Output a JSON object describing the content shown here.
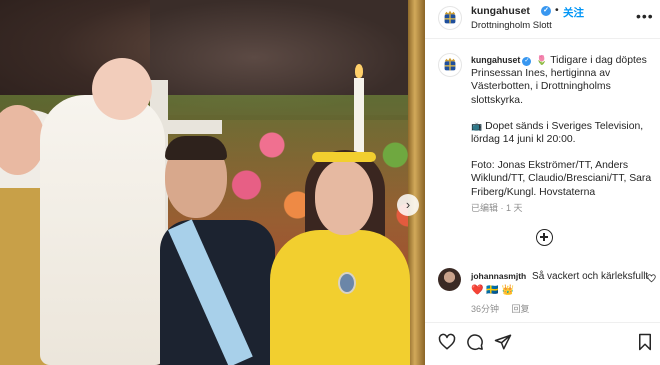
{
  "post": {
    "username": "kungahuset",
    "follow_dot": "•",
    "follow_label": "关注",
    "location": "Drottningholm Slott",
    "more_label": "•••"
  },
  "caption": {
    "username": "kungahuset",
    "line1_emoji": "🌷",
    "line1": "Tidigare i dag döptes Prinsessan Ines, hertiginna av Västerbotten, i Drottningholms slottskyrka.",
    "line2_emoji": "📺",
    "line2": "Dopet sänds i Sveriges Television, lördag 14 juni kl 20:00.",
    "line3": "Foto: Jonas Ekströmer/TT, Anders Wiklund/TT, Claudio/Bresciani/TT, Sara Friberg/Kungl. Hovstaterna",
    "edited": "已编辑",
    "dot": "·",
    "time": "1 天"
  },
  "comment": {
    "username": "johannasmjth",
    "text": "Så vackert och kärleksfullt",
    "emojis": "❤️ 🇸🇪 👑",
    "time": "36分钟",
    "reply": "回复"
  },
  "photo": {
    "next_arrow": "›"
  },
  "icons": {
    "header_avatar": "royal-crest-icon",
    "like": "heart-icon",
    "comment": "comment-icon",
    "share": "paper-plane-icon",
    "save": "bookmark-icon",
    "load_more": "plus-circle-icon"
  },
  "colors": {
    "accent": "#0095f6",
    "verified": "#3897f0",
    "muted": "#8e8e8e",
    "text": "#262626"
  }
}
